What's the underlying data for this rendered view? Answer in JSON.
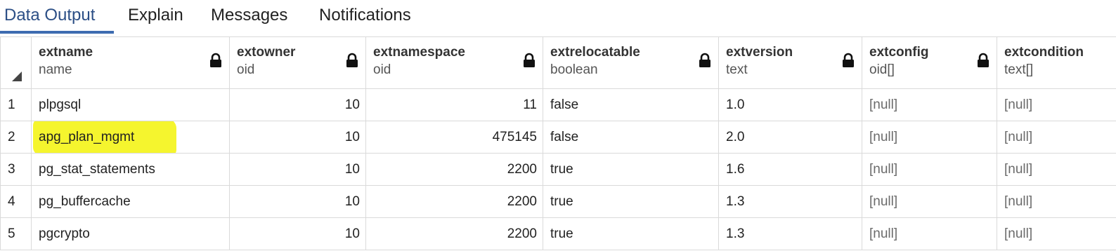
{
  "tabs": [
    {
      "label": "Data Output",
      "active": true
    },
    {
      "label": "Explain",
      "active": false
    },
    {
      "label": "Messages",
      "active": false
    },
    {
      "label": "Notifications",
      "active": false
    }
  ],
  "grid": {
    "columns": [
      {
        "name": "extname",
        "type": "name",
        "locked": true
      },
      {
        "name": "extowner",
        "type": "oid",
        "locked": true
      },
      {
        "name": "extnamespace",
        "type": "oid",
        "locked": true
      },
      {
        "name": "extrelocatable",
        "type": "boolean",
        "locked": true
      },
      {
        "name": "extversion",
        "type": "text",
        "locked": true
      },
      {
        "name": "extconfig",
        "type": "oid[]",
        "locked": true
      },
      {
        "name": "extcondition",
        "type": "text[]",
        "locked": false
      }
    ],
    "rows": [
      {
        "num": "1",
        "cells": [
          "plpgsql",
          "10",
          "11",
          "false",
          "1.0",
          "[null]",
          "[null]"
        ]
      },
      {
        "num": "2",
        "cells": [
          "apg_plan_mgmt",
          "10",
          "475145",
          "false",
          "2.0",
          "[null]",
          "[null]"
        ],
        "highlighted": true
      },
      {
        "num": "3",
        "cells": [
          "pg_stat_statements",
          "10",
          "2200",
          "true",
          "1.6",
          "[null]",
          "[null]"
        ]
      },
      {
        "num": "4",
        "cells": [
          "pg_buffercache",
          "10",
          "2200",
          "true",
          "1.3",
          "[null]",
          "[null]"
        ]
      },
      {
        "num": "5",
        "cells": [
          "pgcrypto",
          "10",
          "2200",
          "true",
          "1.3",
          "[null]",
          "[null]"
        ]
      }
    ]
  },
  "colors": {
    "active_tab": "#2c4f86",
    "highlight": "#f5f52e",
    "null_text": "#6b6b6b"
  }
}
